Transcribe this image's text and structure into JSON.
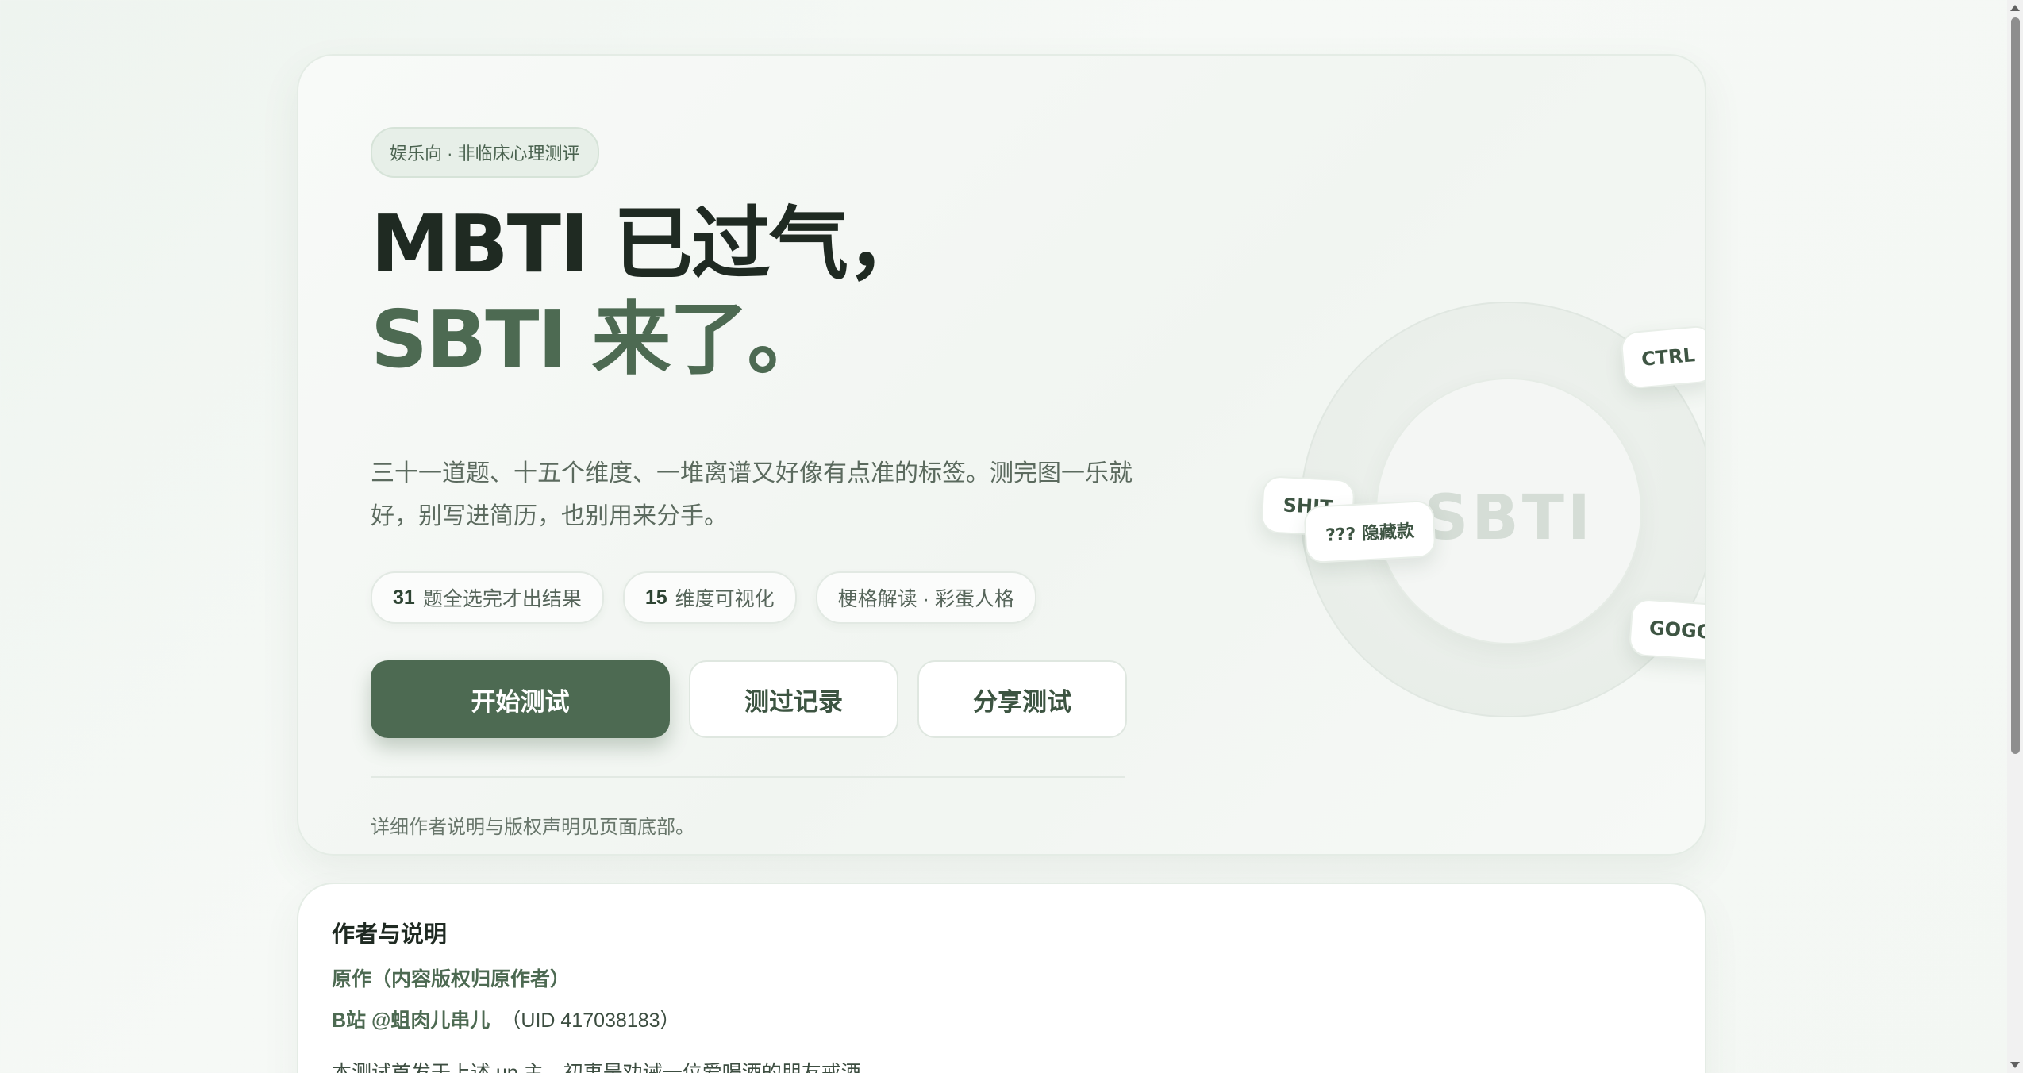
{
  "hero": {
    "pill": "娱乐向 · 非临床心理测评",
    "title_line1": "MBTI 已过气，",
    "title_line2": "SBTI 来了。",
    "description": "三十一道题、十五个维度、一堆离谱又好像有点准的标签。测完图一乐就好，别写进简历，也别用来分手。",
    "tags": [
      {
        "number": "31",
        "label": "题全选完才出结果"
      },
      {
        "number": "15",
        "label": "维度可视化"
      },
      {
        "number": "",
        "label": "梗格解读 · 彩蛋人格"
      }
    ],
    "buttons": {
      "start": "开始测试",
      "history": "测过记录",
      "share": "分享测试"
    },
    "footnote": "详细作者说明与版权声明见页面底部。"
  },
  "visual": {
    "core_label": "SBTI",
    "chips": {
      "ctrl": "CTRL",
      "gogo": "GOGO",
      "shit": "SHIT",
      "hidden": "??? 隐藏款"
    }
  },
  "author": {
    "title": "作者与说明",
    "subtitle": "原作（内容版权归原作者）",
    "credit_name": "B站 @蛆肉儿串儿",
    "credit_uid": "（UID 417038183）",
    "description": "本测试首发于上述 up 主，初衷是劝诫一位爱喝酒的朋友戒酒。"
  },
  "colors": {
    "accent": "#4d6a52",
    "text_dark": "#1f2a22",
    "background": "#f3f7f3"
  }
}
